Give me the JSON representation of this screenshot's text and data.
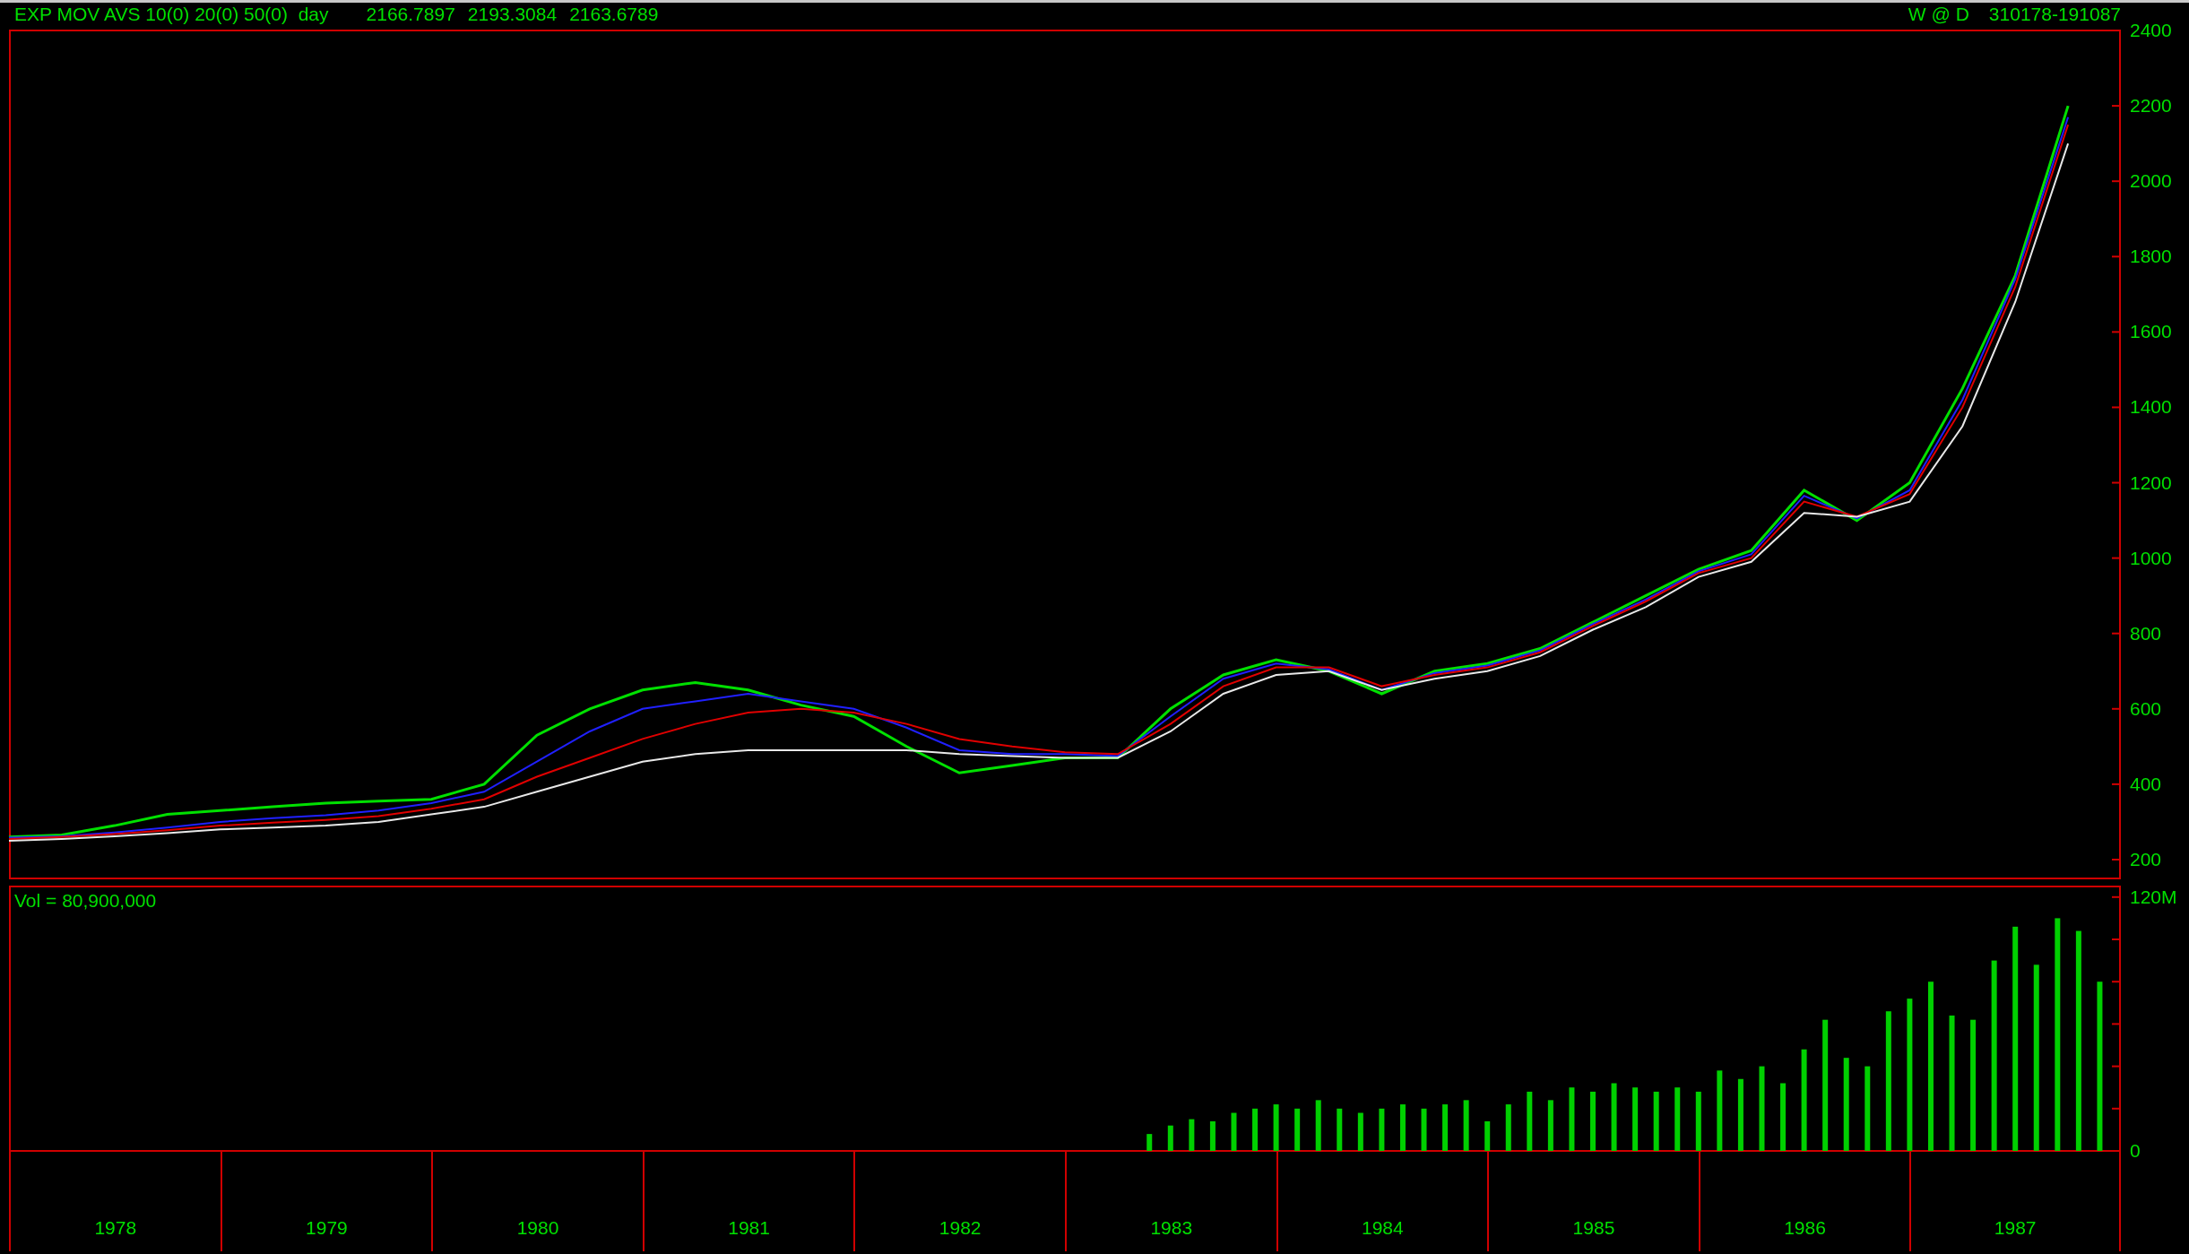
{
  "header": {
    "study": "EXP MOV AVS 10(0) 20(0) 50(0)  day",
    "readings": [
      "2166.7897",
      "2193.3084",
      "2163.6789"
    ],
    "period": "W @ D",
    "date_range": "310178-191087"
  },
  "price_chart": {
    "chart_data": {
      "type": "line",
      "categories": [
        null,
        null,
        null,
        null,
        null,
        null,
        null,
        null,
        null,
        null,
        null,
        null,
        null,
        null,
        null,
        null,
        null,
        null,
        null,
        null,
        null,
        null,
        null,
        null,
        null,
        null,
        null,
        null,
        null,
        null,
        null,
        null,
        null,
        null,
        null,
        null,
        null,
        null,
        null,
        null
      ],
      "series": [
        {
          "color": "#00e000",
          "values": [
            260,
            265,
            290,
            320,
            330,
            340,
            350,
            355,
            360,
            400,
            530,
            600,
            650,
            670,
            650,
            610,
            580,
            500,
            430,
            450,
            470,
            470,
            600,
            690,
            730,
            700,
            640,
            700,
            720,
            760,
            830,
            900,
            970,
            1020,
            1180,
            1100,
            1200,
            1450,
            1750,
            2200
          ]
        },
        {
          "color": "#2020ff",
          "values": [
            258,
            262,
            272,
            285,
            300,
            310,
            318,
            330,
            350,
            380,
            460,
            540,
            600,
            620,
            640,
            620,
            600,
            550,
            490,
            480,
            480,
            475,
            580,
            680,
            720,
            705,
            650,
            695,
            715,
            755,
            825,
            890,
            965,
            1010,
            1165,
            1105,
            1180,
            1420,
            1740,
            2170
          ]
        },
        {
          "color": "#e00000",
          "values": [
            255,
            260,
            268,
            278,
            290,
            298,
            305,
            315,
            335,
            360,
            420,
            470,
            520,
            560,
            590,
            600,
            590,
            560,
            520,
            500,
            485,
            480,
            560,
            660,
            710,
            710,
            660,
            690,
            710,
            750,
            820,
            885,
            960,
            1000,
            1150,
            1110,
            1170,
            1400,
            1720,
            2150
          ]
        },
        {
          "color": "#e8e8e8",
          "values": [
            250,
            255,
            262,
            270,
            280,
            285,
            290,
            300,
            320,
            340,
            380,
            420,
            460,
            480,
            490,
            490,
            490,
            490,
            480,
            475,
            470,
            470,
            540,
            640,
            690,
            700,
            650,
            680,
            700,
            740,
            810,
            870,
            950,
            990,
            1120,
            1110,
            1150,
            1350,
            1680,
            2100
          ]
        }
      ],
      "ylim": [
        150,
        2400
      ],
      "yticks": [
        200,
        400,
        600,
        800,
        1000,
        1200,
        1400,
        1600,
        1800,
        2000,
        2200,
        2400
      ]
    }
  },
  "volume_chart": {
    "label": "Vol = 80,900,000",
    "chart_data": {
      "type": "bar",
      "x": [
        1983.4,
        1983.5,
        1983.6,
        1983.7,
        1983.8,
        1983.9,
        1984,
        1984.1,
        1984.2,
        1984.3,
        1984.4,
        1984.5,
        1984.6,
        1984.7,
        1984.8,
        1984.9,
        1985,
        1985.1,
        1985.2,
        1985.3,
        1985.4,
        1985.5,
        1985.6,
        1985.7,
        1985.8,
        1985.9,
        1986,
        1986.1,
        1986.2,
        1986.3,
        1986.4,
        1986.5,
        1986.6,
        1986.7,
        1986.8,
        1986.9,
        1987,
        1987.1,
        1987.2,
        1987.3,
        1987.4,
        1987.5,
        1987.6,
        1987.7,
        1987.8,
        1987.9
      ],
      "series": [
        {
          "color": "#00d000",
          "values": [
            8,
            12,
            15,
            14,
            18,
            20,
            22,
            20,
            24,
            20,
            18,
            20,
            22,
            20,
            22,
            24,
            14,
            22,
            28,
            24,
            30,
            28,
            32,
            30,
            28,
            30,
            28,
            38,
            34,
            40,
            32,
            48,
            62,
            44,
            40,
            66,
            72,
            80,
            64,
            62,
            90,
            106,
            88,
            110,
            104,
            80
          ]
        }
      ],
      "xlim": [
        1978,
        1988
      ],
      "ylim": [
        0,
        125
      ],
      "yticks": [
        {
          "value": 0,
          "label": "0"
        },
        {
          "value": 120,
          "label": "120M"
        }
      ],
      "xticks": [
        {
          "value": 1978.5,
          "label": "1978"
        },
        {
          "value": 1979.5,
          "label": "1979"
        },
        {
          "value": 1980.5,
          "label": "1980"
        },
        {
          "value": 1981.5,
          "label": "1981"
        },
        {
          "value": 1982.5,
          "label": "1982"
        },
        {
          "value": 1983.5,
          "label": "1983"
        },
        {
          "value": 1984.5,
          "label": "1984"
        },
        {
          "value": 1985.5,
          "label": "1985"
        },
        {
          "value": 1986.5,
          "label": "1986"
        },
        {
          "value": 1987.5,
          "label": "1987"
        }
      ]
    }
  }
}
